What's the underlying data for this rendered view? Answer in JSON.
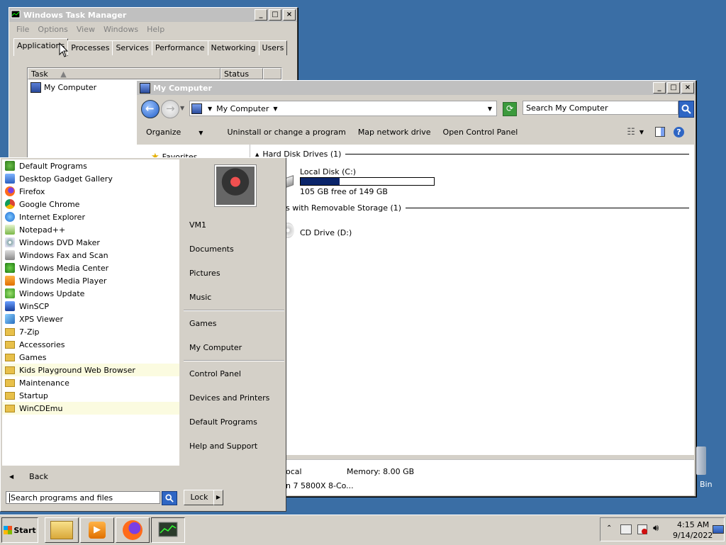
{
  "task_manager": {
    "title": "Windows Task Manager",
    "menu": [
      "File",
      "Options",
      "View",
      "Windows",
      "Help"
    ],
    "tabs": [
      "Applications",
      "Processes",
      "Services",
      "Performance",
      "Networking",
      "Users"
    ],
    "columns": {
      "task": "Task",
      "status": "Status"
    },
    "rows": [
      {
        "task": "My Computer"
      }
    ]
  },
  "explorer": {
    "title": "My Computer",
    "address": "My Computer",
    "search_placeholder": "Search My Computer",
    "commands": [
      "Organize",
      "Uninstall or change a program",
      "Map network drive",
      "Open Control Panel"
    ],
    "nav_favorites": "Favorites",
    "groups": {
      "hdd": "Hard Disk Drives (1)",
      "removable": "s with Removable Storage (1)"
    },
    "local_disk": {
      "name": "Local Disk (C:)",
      "free_text": "105 GB free of 149 GB",
      "used_fraction": 0.295
    },
    "cd_drive": "CD Drive (D:)",
    "details": {
      "workgroup_fragment": "ocal",
      "memory": "Memory: 8.00 GB",
      "processor_fragment": "n 7 5800X 8-Co..."
    }
  },
  "start_menu": {
    "programs": [
      {
        "label": "Default Programs",
        "icon": "default-programs-icon",
        "kind": "app"
      },
      {
        "label": "Desktop Gadget Gallery",
        "icon": "gadget-gallery-icon",
        "kind": "app"
      },
      {
        "label": "Firefox",
        "icon": "firefox-icon",
        "kind": "app"
      },
      {
        "label": "Google Chrome",
        "icon": "chrome-icon",
        "kind": "app"
      },
      {
        "label": "Internet Explorer",
        "icon": "internet-explorer-icon",
        "kind": "app"
      },
      {
        "label": "Notepad++",
        "icon": "notepad-plus-plus-icon",
        "kind": "app"
      },
      {
        "label": "Windows DVD Maker",
        "icon": "dvd-maker-icon",
        "kind": "app"
      },
      {
        "label": "Windows Fax and Scan",
        "icon": "fax-scan-icon",
        "kind": "app"
      },
      {
        "label": "Windows Media Center",
        "icon": "media-center-icon",
        "kind": "app"
      },
      {
        "label": "Windows Media Player",
        "icon": "media-player-icon",
        "kind": "app"
      },
      {
        "label": "Windows Update",
        "icon": "windows-update-icon",
        "kind": "app"
      },
      {
        "label": "WinSCP",
        "icon": "winscp-icon",
        "kind": "app"
      },
      {
        "label": "XPS Viewer",
        "icon": "xps-viewer-icon",
        "kind": "app"
      },
      {
        "label": "7-Zip",
        "icon": "folder-icon",
        "kind": "folder"
      },
      {
        "label": "Accessories",
        "icon": "folder-icon",
        "kind": "folder"
      },
      {
        "label": "Games",
        "icon": "folder-icon",
        "kind": "folder"
      },
      {
        "label": "Kids Playground Web Browser",
        "icon": "folder-icon",
        "kind": "folder",
        "highlight": true
      },
      {
        "label": "Maintenance",
        "icon": "folder-icon",
        "kind": "folder"
      },
      {
        "label": "Startup",
        "icon": "folder-icon",
        "kind": "folder"
      },
      {
        "label": "WinCDEmu",
        "icon": "folder-icon",
        "kind": "folder",
        "highlight": true
      }
    ],
    "back_label": "Back",
    "search_placeholder": "Search programs and files",
    "right_items": [
      "VM1",
      "Documents",
      "Pictures",
      "Music",
      "Games",
      "My Computer",
      "Control Panel",
      "Devices and Printers",
      "Default Programs",
      "Help and Support"
    ],
    "lock_label": "Lock"
  },
  "taskbar": {
    "start_label": "Start",
    "clock_time": "4:15 AM",
    "clock_date": "9/14/2022"
  },
  "desktop": {
    "recycle_bin_fragment": "Bin"
  },
  "colors": {
    "desktop": "#3a6ea5",
    "titlebar": "#c0c0c0",
    "face": "#d4d0c8",
    "progress": "#0a246a"
  }
}
